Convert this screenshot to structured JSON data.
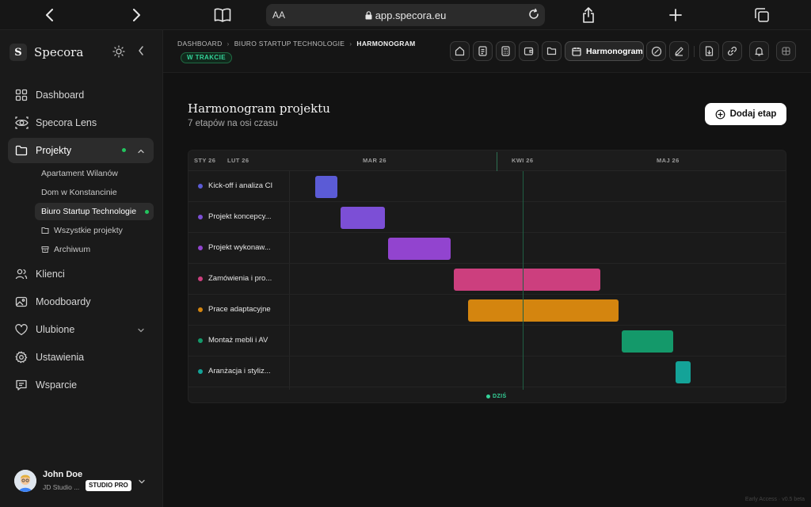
{
  "browser": {
    "text_size_label": "AA",
    "url": "app.specora.eu"
  },
  "sidebar": {
    "brand_letter": "S",
    "brand_name": "Specora",
    "items": [
      {
        "label": "Dashboard",
        "icon": "grid-icon"
      },
      {
        "label": "Specora Lens",
        "icon": "eye-icon"
      },
      {
        "label": "Projekty",
        "icon": "folder-icon",
        "active": true
      },
      {
        "label": "Klienci",
        "icon": "users-icon"
      },
      {
        "label": "Moodboardy",
        "icon": "image-icon"
      },
      {
        "label": "Ulubione",
        "icon": "heart-icon"
      },
      {
        "label": "Ustawienia",
        "icon": "gear-icon"
      },
      {
        "label": "Wsparcie",
        "icon": "chat-icon"
      }
    ],
    "projects": [
      {
        "label": "Apartament Wilanów"
      },
      {
        "label": "Dom w Konstancinie"
      },
      {
        "label": "Biuro Startup Technologie",
        "active": true
      },
      {
        "label": "Wszystkie projekty"
      },
      {
        "label": "Archiwum"
      }
    ],
    "user": {
      "name": "John Doe",
      "studio": "JD Studio ...",
      "plan": "STUDIO PRO"
    }
  },
  "header": {
    "breadcrumb": [
      "DASHBOARD",
      "BIURO STARTUP TECHNOLOGIE",
      "HARMONOGRAM"
    ],
    "status": "W TRAKCIE",
    "active_tab": "Harmonogram"
  },
  "page": {
    "title": "Harmonogram projektu",
    "subtitle": "7 etapów na osi czasu",
    "add_button": "Dodaj etap"
  },
  "gantt": {
    "months": [
      "STY 26",
      "LUT 26",
      "MAR 26",
      "KWI 26",
      "MAJ 26"
    ],
    "today_label": "DZIŚ",
    "stages": [
      {
        "label": "Kick-off i analiza CI",
        "color": "#5b5bd6"
      },
      {
        "label": "Projekt koncepcy...",
        "color": "#7c4fd6"
      },
      {
        "label": "Projekt wykonaw...",
        "color": "#9244cf"
      },
      {
        "label": "Zamówienia i pro...",
        "color": "#cc3f7e"
      },
      {
        "label": "Prace adaptacyjne",
        "color": "#d4850f"
      },
      {
        "label": "Montaż mebli i AV",
        "color": "#14996a"
      },
      {
        "label": "Aranżacja i styliz...",
        "color": "#14a398"
      }
    ]
  },
  "footer": {
    "note": "Early Access · v0.5 beta"
  }
}
